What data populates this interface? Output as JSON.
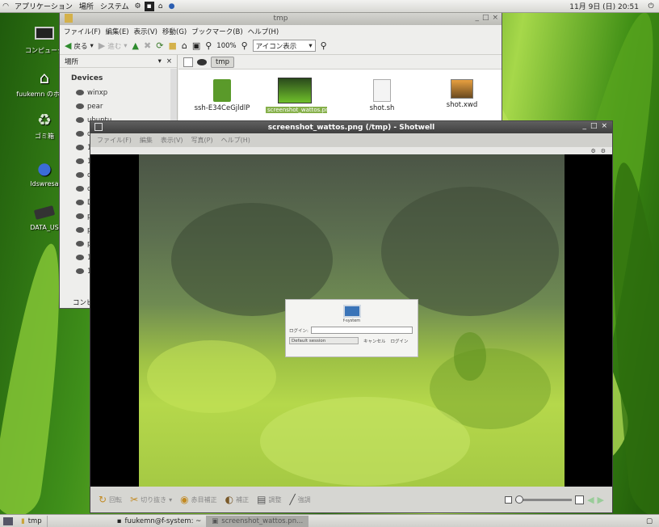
{
  "top_panel": {
    "menus": [
      "アプリケーション",
      "場所",
      "システム"
    ],
    "clock": "11月 9日 (日) 20:51"
  },
  "desktop_icons": [
    {
      "label": "コンピュータ"
    },
    {
      "label": "fuukemn のホーム"
    },
    {
      "label": "ゴミ箱"
    },
    {
      "label": "ldswresa"
    },
    {
      "label": "DATA_US"
    }
  ],
  "file_manager": {
    "title": "tmp",
    "menu": [
      "ファイル(F)",
      "編集(E)",
      "表示(V)",
      "移動(G)",
      "ブックマーク(B)",
      "ヘルプ(H)"
    ],
    "toolbar": {
      "back": "戻る",
      "forward": "進む",
      "zoom": "100%",
      "view_mode": "アイコン表示"
    },
    "sidebar": {
      "header": "場所",
      "section": "Devices",
      "items": [
        "winxp",
        "pear",
        "ubuntu",
        "d",
        "1",
        "1",
        "d",
        "c",
        "D",
        "p",
        "p",
        "p",
        "1",
        "1"
      ],
      "footer": "コンピ"
    },
    "path": "tmp",
    "files": [
      {
        "name": "ssh-E34CeGjldlP"
      },
      {
        "name": "screenshot_wattos.png"
      },
      {
        "name": "shot.sh"
      },
      {
        "name": "shot.xwd"
      }
    ]
  },
  "shotwell": {
    "title": "screenshot_wattos.png (/tmp) - Shotwell",
    "menu": [
      "ファイル(F)",
      "編集",
      "表示(V)",
      "写真(P)",
      "ヘルプ(H)"
    ],
    "login": {
      "computer_name": "f-system",
      "prompt": "ログイン:",
      "session": "Default session",
      "cancel": "キャンセル",
      "login": "ログイン"
    },
    "toolbar": [
      "回転",
      "切り抜き",
      "赤目補正",
      "補正",
      "調整",
      "強調"
    ]
  },
  "taskbar": [
    {
      "label": "tmp"
    },
    {
      "label": "fuukemn@f-system: ~"
    },
    {
      "label": "screenshot_wattos.pn..."
    }
  ],
  "colors": {
    "panel": "#dcdcd8",
    "window_title_active": "#4a4a4a",
    "desktop_green": "#5fa01e"
  }
}
